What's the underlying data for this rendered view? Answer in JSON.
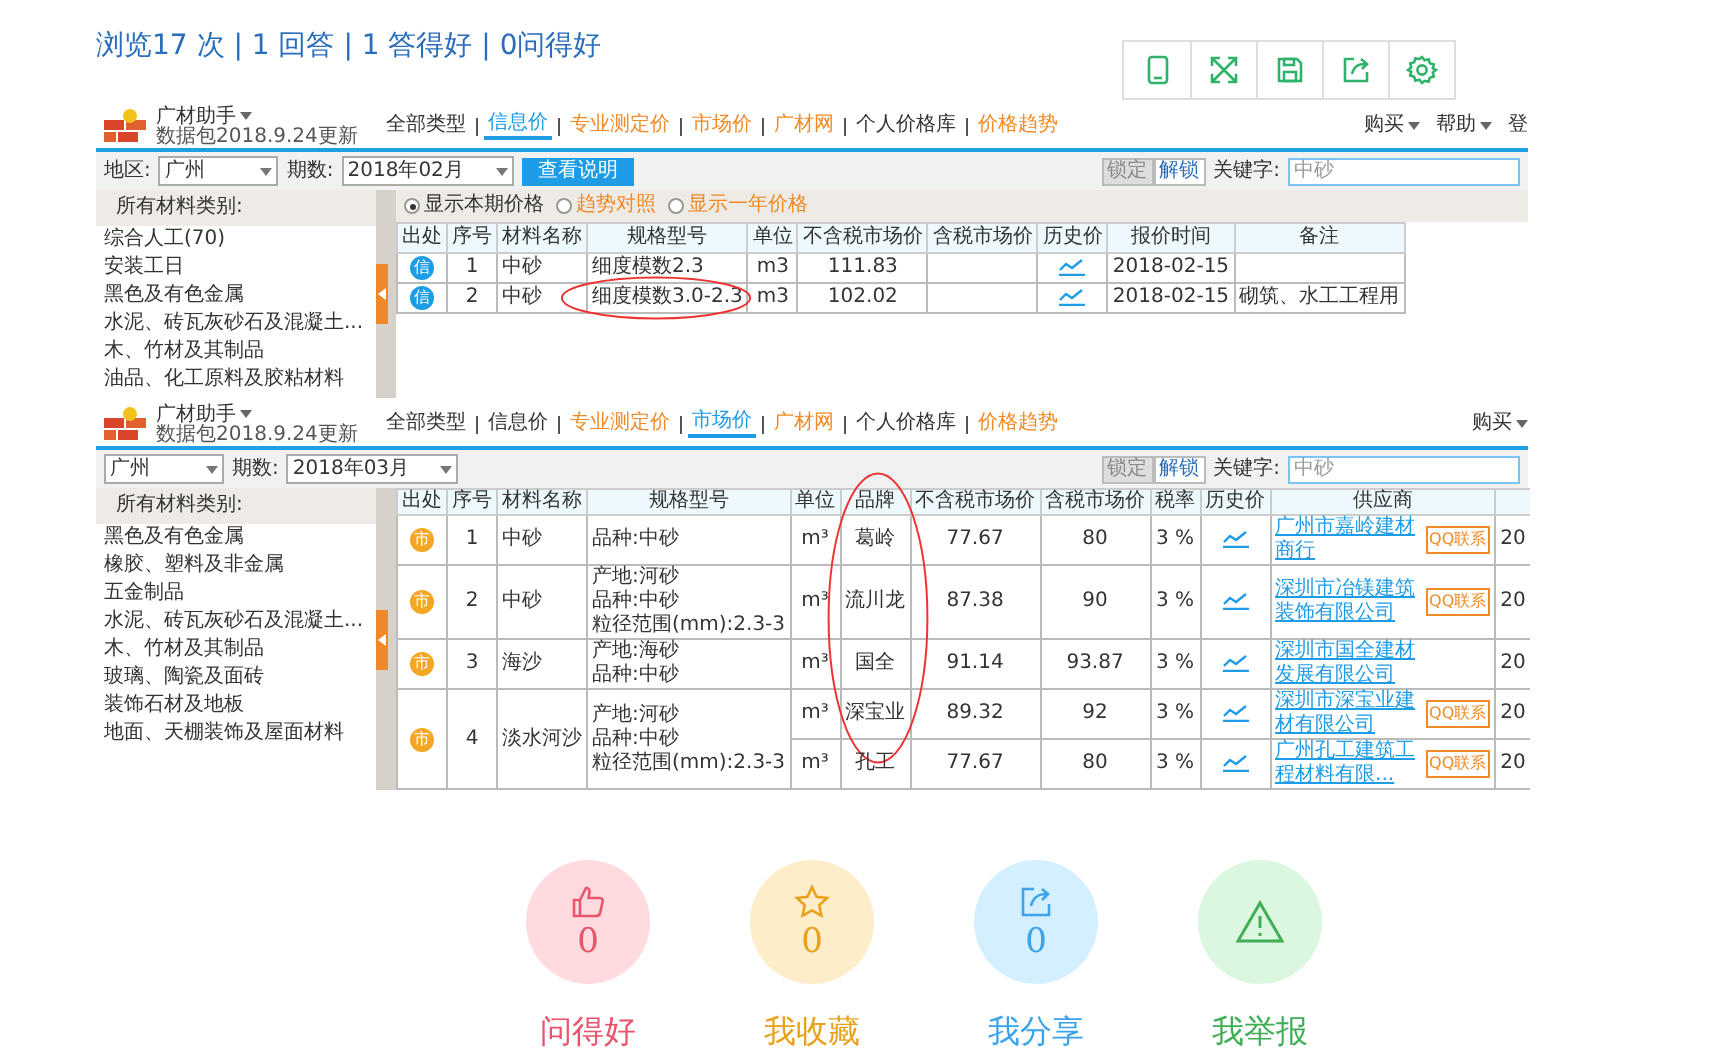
{
  "stats": "浏览17 次 | 1 回答 | 1 答得好 | 0问得好",
  "screenshots": [
    {
      "kind": "info",
      "app_name": "广材助手",
      "update_note": "数据包2018.9.24更新",
      "tabs": [
        {
          "label": "全部类型",
          "selected": false,
          "kind": "plain"
        },
        {
          "label": "信息价",
          "selected": true
        },
        {
          "label": "专业测定价",
          "selected": false,
          "kind": "highlight"
        },
        {
          "label": "市场价",
          "selected": false,
          "kind": "highlight"
        },
        {
          "label": "广材网",
          "selected": false,
          "kind": "highlight"
        },
        {
          "label": "个人价格库",
          "selected": false,
          "kind": "plain"
        },
        {
          "label": "价格趋势",
          "selected": false,
          "kind": "highlight"
        }
      ],
      "menus": [
        "购买",
        "帮助"
      ],
      "menu_cut": "登",
      "region_label": "地区:",
      "region": "广州",
      "period_label": "期数:",
      "period": "2018年02月",
      "help_button": "查看说明",
      "lock_button": "锁定",
      "unlock_button": "解锁",
      "keyword_label": "关键字:",
      "keyword": "中砂",
      "sidebar_title": "所有材料类别:",
      "categories": [
        "综合人工(70)",
        "安装工日",
        "黑色及有色金属",
        "水泥、砖瓦灰砂石及混凝土...",
        "木、竹材及其制品",
        "油品、化工原料及胶粘材料"
      ],
      "options": [
        {
          "label": "显示本期价格",
          "selected": true
        },
        {
          "label": "趋势对照",
          "selected": false
        },
        {
          "label": "显示一年价格",
          "selected": false
        }
      ],
      "columns": [
        "出处",
        "序号",
        "材料名称",
        "规格型号",
        "单位",
        "不含税市场价",
        "含税市场价",
        "历史价",
        "报价时间",
        "备注"
      ],
      "rows": [
        {
          "source": "信",
          "no": "1",
          "name": "中砂",
          "spec": [
            "细度模数2.3"
          ],
          "unit": "m3",
          "price_ex": "111.83",
          "date": "2018-02-15"
        },
        {
          "source": "信",
          "no": "2",
          "name": "中砂",
          "spec": [
            "细度模数3.0-2.3"
          ],
          "unit": "m3",
          "price_ex": "102.02",
          "date": "2018-02-15",
          "note": "砌筑、水工工程用"
        }
      ]
    },
    {
      "kind": "market",
      "app_name": "广材助手",
      "update_note": "数据包2018.9.24更新",
      "tabs": [
        {
          "label": "全部类型",
          "selected": false,
          "kind": "plain"
        },
        {
          "label": "信息价",
          "selected": false,
          "kind": "plain"
        },
        {
          "label": "专业测定价",
          "selected": false,
          "kind": "highlight"
        },
        {
          "label": "市场价",
          "selected": true
        },
        {
          "label": "广材网",
          "selected": false,
          "kind": "highlight"
        },
        {
          "label": "个人价格库",
          "selected": false,
          "kind": "plain"
        },
        {
          "label": "价格趋势",
          "selected": false,
          "kind": "highlight"
        }
      ],
      "menus": [
        "购买"
      ],
      "region": "广州",
      "period_label": "期数:",
      "period": "2018年03月",
      "lock_button": "锁定",
      "unlock_button": "解锁",
      "keyword_label": "关键字:",
      "keyword": "中砂",
      "sidebar_title": "所有材料类别:",
      "categories": [
        "黑色及有色金属",
        "橡胶、塑料及非金属",
        "五金制品",
        "水泥、砖瓦灰砂石及混凝土...",
        "木、竹材及其制品",
        "玻璃、陶瓷及面砖",
        "装饰石材及地板",
        "地面、天棚装饰及屋面材料"
      ],
      "columns": [
        "出处",
        "序号",
        "材料名称",
        "规格型号",
        "单位",
        "品牌",
        "不含税市场价",
        "含税市场价",
        "税率",
        "历史价",
        "供应商"
      ],
      "rows": [
        {
          "source": "市",
          "no": "1",
          "name": "中砂",
          "spec": [
            "品种:中砂"
          ],
          "offers": [
            {
              "unit": "m³",
              "brand": "葛岭",
              "price_ex": "77.67",
              "price_in": "80",
              "tax": "3 %",
              "supplier": "广州市嘉岭建材商行",
              "badge": "QQ联系",
              "column_12": "20"
            }
          ]
        },
        {
          "source": "市",
          "no": "2",
          "name": "中砂",
          "spec": [
            "产地:河砂",
            "品种:中砂",
            "粒径范围(mm):2.3-3"
          ],
          "offers": [
            {
              "unit": "m³",
              "brand": "流川龙",
              "price_ex": "87.38",
              "price_in": "90",
              "tax": "3 %",
              "supplier": "深圳市冶镁建筑装饰有限公司",
              "badge": "QQ联系",
              "column_12": "20"
            }
          ]
        },
        {
          "source": "市",
          "no": "3",
          "name": "海沙",
          "spec": [
            "产地:海砂",
            "品种:中砂"
          ],
          "offers": [
            {
              "unit": "m³",
              "brand": "国全",
              "price_ex": "91.14",
              "price_in": "93.87",
              "tax": "3 %",
              "supplier": "深圳市国全建材发展有限公司",
              "column_12": "20"
            }
          ]
        },
        {
          "source": "市",
          "no": "4",
          "name": "淡水河沙",
          "spec": [
            "产地:河砂",
            "品种:中砂",
            "粒径范围(mm):2.3-3"
          ],
          "offers": [
            {
              "unit": "m³",
              "brand": "深宝业",
              "price_ex": "89.32",
              "price_in": "92",
              "tax": "3 %",
              "supplier": "深圳市深宝业建材有限公司",
              "badge": "QQ联系",
              "column_12": "20"
            },
            {
              "unit": "m³",
              "brand": "孔工",
              "price_ex": "77.67",
              "price_in": "80",
              "tax": "3 %",
              "supplier": "广州孔工建筑工程材料有限...",
              "badge": "QQ联系",
              "column_12": "20"
            }
          ]
        }
      ]
    }
  ],
  "actions": [
    {
      "kind": "like",
      "label": "问得好",
      "count": "0"
    },
    {
      "kind": "favorite",
      "label": "我收藏",
      "count": "0"
    },
    {
      "kind": "share",
      "label": "我分享",
      "count": "0"
    },
    {
      "kind": "report",
      "label": "我举报"
    }
  ]
}
